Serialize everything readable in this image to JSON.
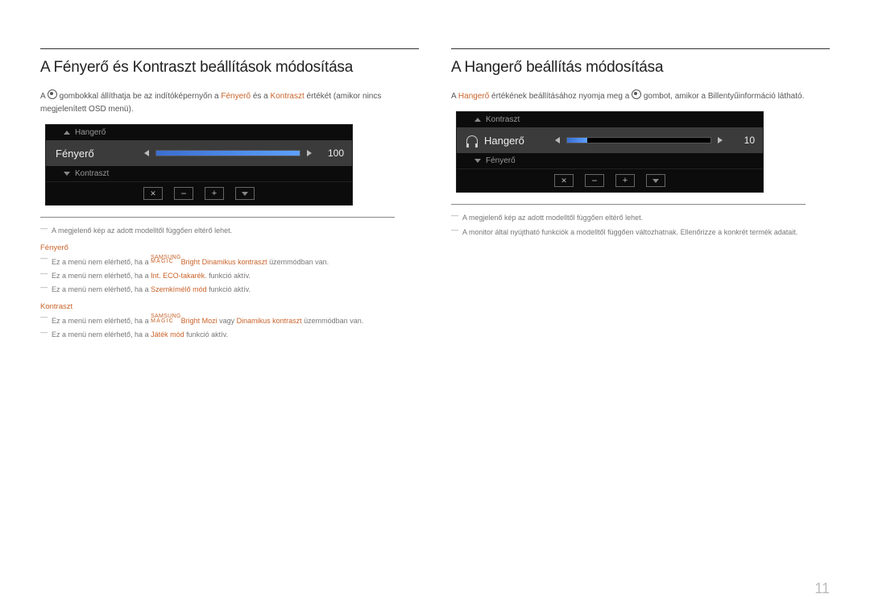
{
  "page_number": "11",
  "left": {
    "title": "A Fényerő és Kontraszt beállítások módosítása",
    "intro_1a": "A ",
    "intro_1b": " gombokkal állíthatja be az indítóképernyőn a ",
    "intro_hl1": "Fényerő",
    "intro_1c": " és a ",
    "intro_hl2": "Kontraszt",
    "intro_1d": " értékét (amikor nincs megjelenített OSD menü).",
    "osd": {
      "sub_top": "Hangerő",
      "active_label": "Fényerő",
      "value": "100",
      "fill_percent": 100,
      "sub_bottom": "Kontraszt"
    },
    "note1": "A megjelenő kép az adott modelltől függően eltérő lehet.",
    "head_fenyero": "Fényerő",
    "f_note1_a": "Ez a menü nem elérhető, ha a ",
    "brand_top": "SAMSUNG",
    "brand_bot": "MAGIC",
    "f_note1_b1": "Bright",
    "f_note1_b2": " Dinamikus kontraszt",
    "f_note1_c": " üzemmódban van.",
    "f_note2_a": "Ez a menü nem elérhető, ha a ",
    "f_note2_hl": "Int. ECO-takarék.",
    "f_note2_b": " funkció aktív.",
    "f_note3_a": "Ez a menü nem elérhető, ha a ",
    "f_note3_hl": "Szemkímélő mód",
    "f_note3_b": " funkció aktív.",
    "head_kontraszt": "Kontraszt",
    "k_note1_a": "Ez a menü nem elérhető, ha a ",
    "k_note1_b1": "Bright",
    "k_note1_b2": " Mozi",
    "k_note1_c": " vagy ",
    "k_note1_hl2": "Dinamikus kontraszt",
    "k_note1_d": " üzemmódban van.",
    "k_note2_a": "Ez a menü nem elérhető, ha a ",
    "k_note2_hl": "Játék mód",
    "k_note2_b": " funkció aktív."
  },
  "right": {
    "title": "A Hangerő beállítás módosítása",
    "intro_a": "A ",
    "intro_hl": "Hangerő",
    "intro_b": " értékének beállításához nyomja meg a ",
    "intro_c": " gombot, amikor a Billentyűinformáció látható.",
    "osd": {
      "sub_top": "Kontraszt",
      "active_label": "Hangerő",
      "value": "10",
      "fill_percent": 14,
      "sub_bottom": "Fényerő"
    },
    "note1": "A megjelenő kép az adott modelltől függően eltérő lehet.",
    "note2": "A monitor által nyújtható funkciók a modelltől függően változhatnak. Ellenőrizze a konkrét termék adatait."
  }
}
